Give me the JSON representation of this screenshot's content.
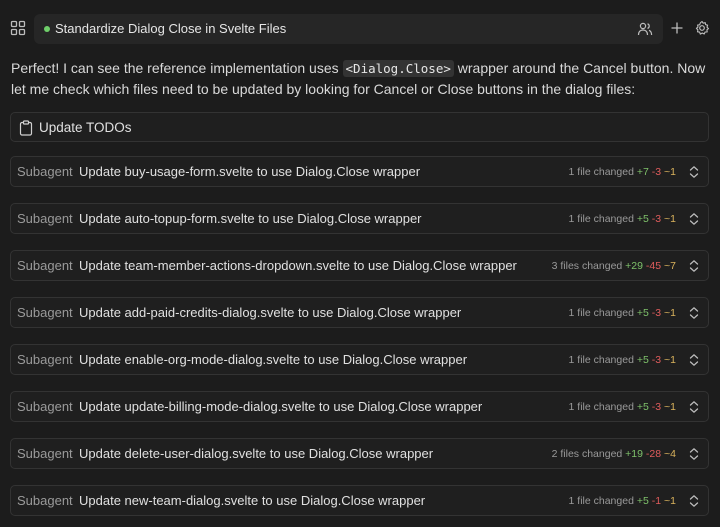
{
  "header": {
    "title": "Standardize Dialog Close in Svelte Files"
  },
  "message": {
    "part1": "Perfect! I can see the reference implementation uses ",
    "code": "<Dialog.Close>",
    "part2": " wrapper around the Cancel button. Now let me check which files need to be updated by looking for Cancel or Close buttons in the dialog files:"
  },
  "todo": {
    "label": "Update TODOs"
  },
  "subagents": [
    {
      "tag": "Subagent",
      "label": "Update buy-usage-form.svelte to use Dialog.Close wrapper",
      "files": "1 file changed",
      "add": "+7",
      "del": "-3",
      "mod": "~1"
    },
    {
      "tag": "Subagent",
      "label": "Update auto-topup-form.svelte to use Dialog.Close wrapper",
      "files": "1 file changed",
      "add": "+5",
      "del": "-3",
      "mod": "~1"
    },
    {
      "tag": "Subagent",
      "label": "Update team-member-actions-dropdown.svelte to use Dialog.Close wrapper",
      "files": "3 files changed",
      "add": "+29",
      "del": "-45",
      "mod": "~7"
    },
    {
      "tag": "Subagent",
      "label": "Update add-paid-credits-dialog.svelte to use Dialog.Close wrapper",
      "files": "1 file changed",
      "add": "+5",
      "del": "-3",
      "mod": "~1"
    },
    {
      "tag": "Subagent",
      "label": "Update enable-org-mode-dialog.svelte to use Dialog.Close wrapper",
      "files": "1 file changed",
      "add": "+5",
      "del": "-3",
      "mod": "~1"
    },
    {
      "tag": "Subagent",
      "label": "Update update-billing-mode-dialog.svelte to use Dialog.Close wrapper",
      "files": "1 file changed",
      "add": "+5",
      "del": "-3",
      "mod": "~1"
    },
    {
      "tag": "Subagent",
      "label": "Update delete-user-dialog.svelte to use Dialog.Close wrapper",
      "files": "2 files changed",
      "add": "+19",
      "del": "-28",
      "mod": "~4"
    },
    {
      "tag": "Subagent",
      "label": "Update new-team-dialog.svelte to use Dialog.Close wrapper",
      "files": "1 file changed",
      "add": "+5",
      "del": "-1",
      "mod": "~1"
    }
  ],
  "colors": {
    "background": "#1c1c1c",
    "added": "#7ec16a",
    "deleted": "#e05c5c",
    "modified": "#d9b25c",
    "status_dot": "#6fcf6a"
  },
  "icons": [
    "grid-icon",
    "users-icon",
    "plus-icon",
    "gear-icon",
    "clipboard-icon",
    "expand-icon"
  ]
}
